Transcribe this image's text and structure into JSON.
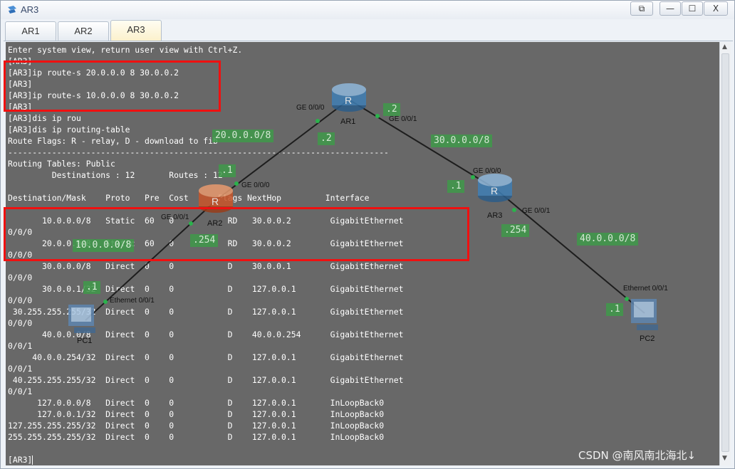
{
  "window": {
    "title": "AR3",
    "controls": {
      "restore": "⧉",
      "minimize": "—",
      "maximize": "☐",
      "close": "X"
    }
  },
  "tabs": [
    {
      "label": "AR1",
      "active": false
    },
    {
      "label": "AR2",
      "active": false
    },
    {
      "label": "AR3",
      "active": true
    }
  ],
  "console": {
    "lines": [
      "Enter system view, return user view with Ctrl+Z.",
      "[AR3]",
      "[AR3]ip route-s 20.0.0.0 8 30.0.0.2",
      "[AR3]",
      "[AR3]ip route-s 10.0.0.0 8 30.0.0.2",
      "[AR3]",
      "[AR3]dis ip rou",
      "[AR3]dis ip routing-table",
      "Route Flags: R - relay, D - download to fib",
      "------------------------------------------------------------------------------",
      "Routing Tables: Public",
      "         Destinations : 12       Routes : 12",
      "",
      "Destination/Mask    Proto   Pre  Cost      Flags NextHop         Interface",
      "",
      "       10.0.0.0/8   Static  60   0           RD   30.0.0.2        GigabitEthernet",
      "0/0/0",
      "       20.0.0.0/8   Static  60   0           RD   30.0.0.2        GigabitEthernet",
      "0/0/0",
      "       30.0.0.0/8   Direct  0    0           D    30.0.0.1        GigabitEthernet",
      "0/0/0",
      "       30.0.0.1/32  Direct  0    0           D    127.0.0.1       GigabitEthernet",
      "0/0/0",
      " 30.255.255.255/32  Direct  0    0           D    127.0.0.1       GigabitEthernet",
      "0/0/0",
      "       40.0.0.0/8   Direct  0    0           D    40.0.0.254      GigabitEthernet",
      "0/0/1",
      "     40.0.0.254/32  Direct  0    0           D    127.0.0.1       GigabitEthernet",
      "0/0/1",
      " 40.255.255.255/32  Direct  0    0           D    127.0.0.1       GigabitEthernet",
      "0/0/1",
      "      127.0.0.0/8   Direct  0    0           D    127.0.0.1       InLoopBack0",
      "      127.0.0.1/32  Direct  0    0           D    127.0.0.1       InLoopBack0",
      "127.255.255.255/32  Direct  0    0           D    127.0.0.1       InLoopBack0",
      "255.255.255.255/32  Direct  0    0           D    127.0.0.1       InLoopBack0",
      "",
      "[AR3]"
    ]
  },
  "topology": {
    "nodes": {
      "ar1": "AR1",
      "ar2": "AR2",
      "ar3": "AR3",
      "pc1": "PC1",
      "pc2": "PC2"
    },
    "interfaces": {
      "ar1_g000": "GE 0/0/0",
      "ar1_g001": "GE 0/0/1",
      "ar2_g000": "GE 0/0/0",
      "ar2_g001": "GE 0/0/1",
      "ar3_g000": "GE 0/0/0",
      "ar3_g001": "GE 0/0/1",
      "pc1_eth": "Ethernet 0/0/1",
      "pc2_eth": "Ethernet 0/0/1"
    },
    "annotations": {
      "net20": "20.0.0.0/8",
      "net30": "30.0.0.0/8",
      "net40": "40.0.0.0/8",
      "net10": "10.0.0.0/8",
      "ar1_left": ".2",
      "ar1_right": ".2",
      "ar2_top": ".1",
      "ar2_bottom": ".254",
      "ar3_top": ".1",
      "ar3_right": ".254",
      "pc1": ".1",
      "pc2": ".1"
    }
  },
  "watermark": "CSDN @南风南北海北↓",
  "colors": {
    "highlight": "#f01010",
    "console_bg": "#686868",
    "label_bg": "#3f9a4a"
  }
}
